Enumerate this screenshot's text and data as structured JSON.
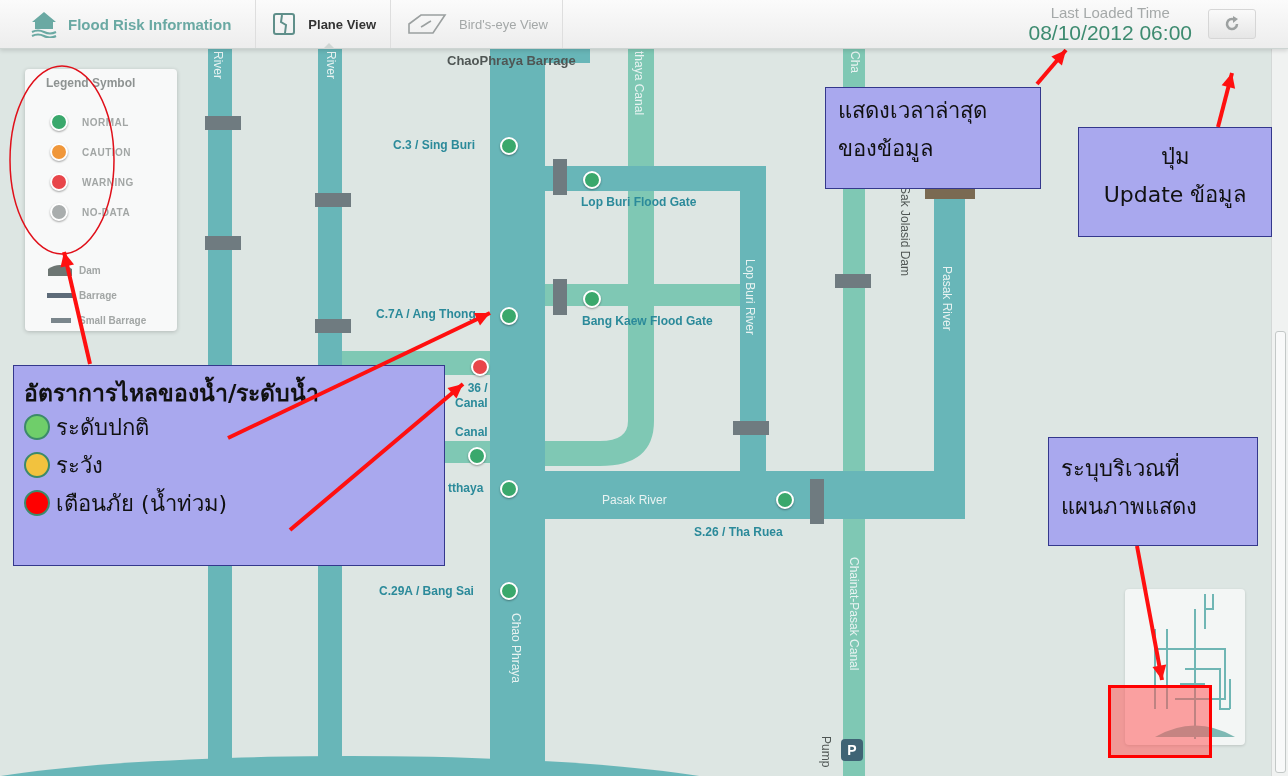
{
  "header": {
    "title": "Flood Risk Information",
    "views": [
      {
        "label": "Plane View",
        "kind": "plane",
        "selected": true
      },
      {
        "label": "Bird's-eye View",
        "kind": "birdseye",
        "selected": false
      }
    ],
    "last_loaded_label": "Last Loaded Time",
    "last_loaded_time": "08/10/2012 06:00"
  },
  "legend": {
    "title": "Legend Symbol",
    "statuses": [
      {
        "label": "NORMAL",
        "color": "#3aa86c"
      },
      {
        "label": "CAUTION",
        "color": "#f0973a"
      },
      {
        "label": "WARNING",
        "color": "#e8464a"
      },
      {
        "label": "NO-DATA",
        "color": "#a9adad"
      }
    ],
    "structures": [
      {
        "label": "Dam",
        "kind": "dam"
      },
      {
        "label": "Barrage",
        "kind": "barrage"
      },
      {
        "label": "Small Barrage",
        "kind": "small_barrage"
      }
    ]
  },
  "map": {
    "labels": [
      {
        "text": "ChaoPhraya Barrage",
        "kind": "place"
      },
      {
        "text": "River",
        "kind": "river_vertical"
      },
      {
        "text": "River",
        "kind": "river_vertical"
      },
      {
        "text": "thaya Canal",
        "kind": "river_vertical"
      },
      {
        "text": "Cha",
        "kind": "river_vertical"
      },
      {
        "text": "Sak Jolasid Dam",
        "kind": "place_vertical"
      },
      {
        "text": "Lop Buri River",
        "kind": "river_vertical"
      },
      {
        "text": "Pasak River",
        "kind": "river_vertical"
      },
      {
        "text": "Pasak River",
        "kind": "river"
      },
      {
        "text": "Chao Phraya",
        "kind": "river_vertical"
      },
      {
        "text": "Chainat-Pasak Canal",
        "kind": "river_vertical"
      },
      {
        "text": "Pump",
        "kind": "place_vertical"
      }
    ],
    "stations": [
      {
        "label_lines": [
          "C.3 / Sing Buri"
        ],
        "color": "#3aa86c"
      },
      {
        "label_lines": [
          "Lop Buri Flood Gate"
        ],
        "color": "#3aa86c"
      },
      {
        "label_lines": [
          "C.7A / Ang Thong"
        ],
        "color": "#3aa86c"
      },
      {
        "label_lines": [
          "Bang Kaew Flood Gate"
        ],
        "color": "#3aa86c"
      },
      {
        "label_lines": [
          "36 /",
          "Canal"
        ],
        "color": "#e8464a"
      },
      {
        "label_lines": [
          "Canal"
        ],
        "color": "#3aa86c"
      },
      {
        "label_lines": [
          "tthaya"
        ],
        "color": "#3aa86c"
      },
      {
        "label_lines": [
          "S.26 / Tha Ruea"
        ],
        "color": "#3aa86c"
      },
      {
        "label_lines": [
          "C.29A / Bang Sai"
        ],
        "color": "#3aa86c"
      }
    ],
    "pump_badge": "P"
  },
  "callouts": {
    "status_note": {
      "title": "อัตราการไหลของน้ำ/ระดับน้ำ",
      "items": [
        {
          "label": "ระดับปกติ",
          "color": "#6fce6a"
        },
        {
          "label": "ระวัง",
          "color": "#f2c23e"
        },
        {
          "label": "เตือนภัย (น้ำท่วม)",
          "color": "#ff0000"
        }
      ]
    },
    "time_note": {
      "lines": [
        "แสดงเวลาล่าสุด",
        "ของข้อมูล"
      ]
    },
    "button_note": {
      "lines": [
        "ปุ่ม",
        "Update ข้อมูล"
      ]
    },
    "area_note": {
      "lines": [
        "ระบุบริเวณที่",
        "แผนภาพแสดง"
      ]
    }
  }
}
